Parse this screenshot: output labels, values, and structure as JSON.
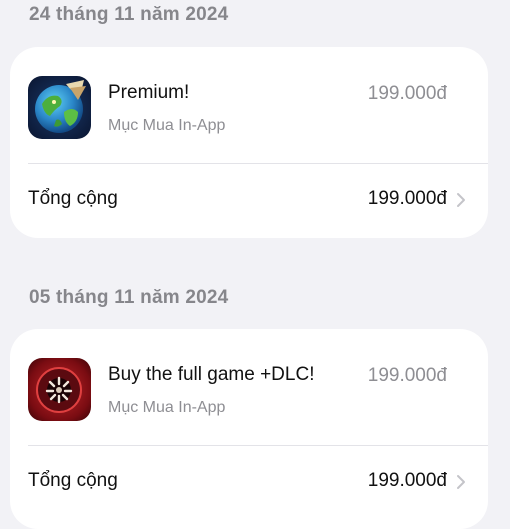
{
  "purchases": [
    {
      "date": "24 tháng 11 năm 2024",
      "item_name": "Premium!",
      "item_type": "Mục Mua In-App",
      "item_price": "199.000đ",
      "total_label": "Tổng cộng",
      "total_price": "199.000đ",
      "icon": "globe-game-icon"
    },
    {
      "date": "05 tháng 11 năm 2024",
      "item_name": "Buy the full game +DLC!",
      "item_type": "Mục Mua In-App",
      "item_price": "199.000đ",
      "total_label": "Tổng cộng",
      "total_price": "199.000đ",
      "icon": "red-monster-game-icon"
    }
  ],
  "colors": {
    "background": "#f2f2f6",
    "card": "#ffffff",
    "secondary_text": "#8e8e93",
    "primary_text": "#111111"
  }
}
